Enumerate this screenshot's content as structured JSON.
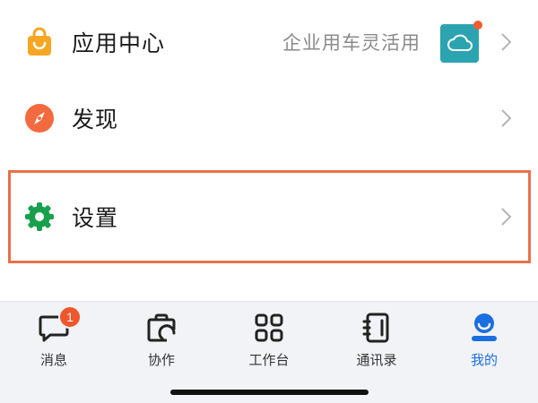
{
  "menu": {
    "app_center": {
      "label": "应用中心",
      "value": "企业用车灵活用",
      "icon": "shopping-bag-icon",
      "icon_color": "#f5a623"
    },
    "discover": {
      "label": "发现",
      "icon": "compass-icon",
      "icon_color": "#f26a3d"
    },
    "settings": {
      "label": "设置",
      "icon": "gear-icon",
      "icon_color": "#19a04b"
    }
  },
  "highlight_color": "#ea7147",
  "tab_bar": {
    "tabs": [
      {
        "label": "消息",
        "icon": "message-icon",
        "badge": "1"
      },
      {
        "label": "协作",
        "icon": "collaboration-icon"
      },
      {
        "label": "工作台",
        "icon": "workbench-grid-icon"
      },
      {
        "label": "通讯录",
        "icon": "contacts-book-icon"
      },
      {
        "label": "我的",
        "icon": "profile-icon",
        "active": true
      }
    ],
    "active_color": "#1c6fe0"
  }
}
